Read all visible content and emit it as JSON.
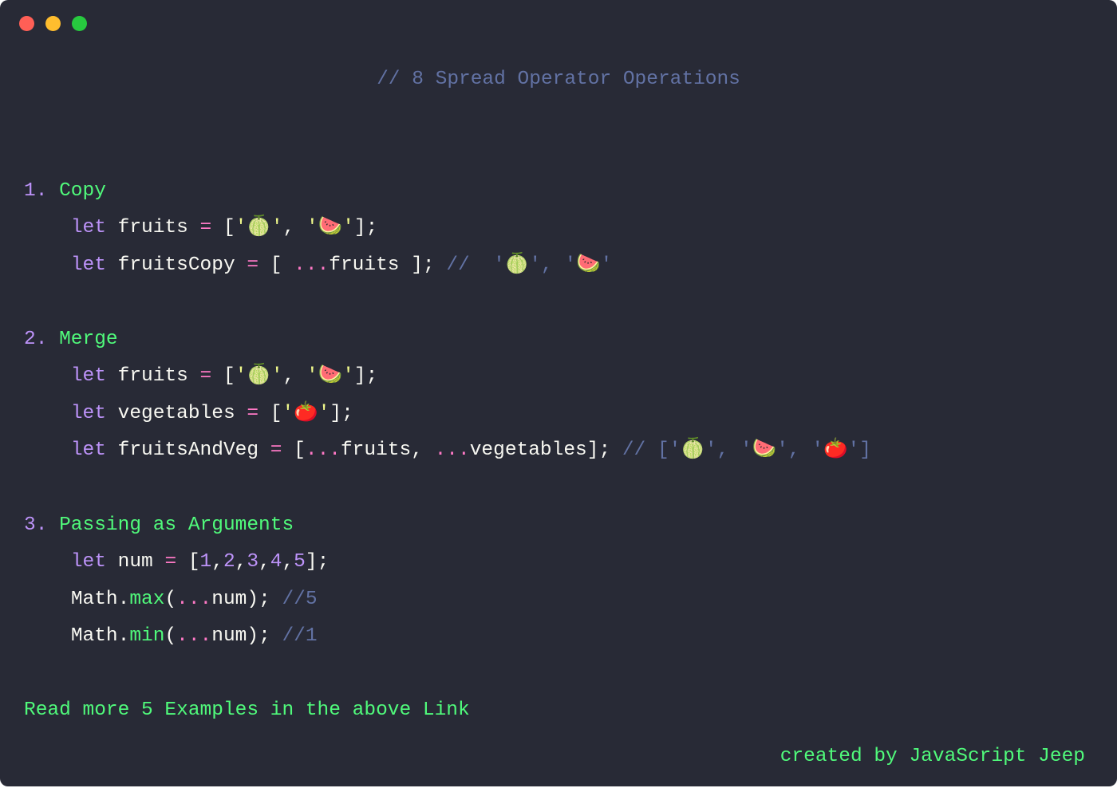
{
  "header_comment": "// 8 Spread Operator Operations",
  "sections": {
    "s1": {
      "num": "1.",
      "title": "Copy"
    },
    "s2": {
      "num": "2.",
      "title": "Merge"
    },
    "s3": {
      "num": "3.",
      "title": "Passing as Arguments"
    }
  },
  "tokens": {
    "let": "let",
    "fruits": "fruits",
    "fruitsCopy": "fruitsCopy",
    "vegetables": "vegetables",
    "fruitsAndVeg": "fruitsAndVeg",
    "num": "num",
    "Math": "Math",
    "max": "max",
    "min": "min",
    "eq": "=",
    "spread": "...",
    "lbrack": "[",
    "rbrack": "]",
    "lparen": "(",
    "rparen": ")",
    "semi": ";",
    "comma": ",",
    "dot": ".",
    "dslash": "//"
  },
  "emoji": {
    "melon": "🍈",
    "watermelon": "🍉",
    "tomato": "🍅"
  },
  "quotes": {
    "open": "'",
    "close": "'"
  },
  "nums": {
    "n1": "1",
    "n2": "2",
    "n3": "3",
    "n4": "4",
    "n5": "5"
  },
  "comments": {
    "copy_result_prefix": "//  ",
    "merge_result_prefix": "// ",
    "five": "//5",
    "one": "//1"
  },
  "readmore": "Read more 5 Examples in the above Link",
  "credit": "created by JavaScript Jeep"
}
